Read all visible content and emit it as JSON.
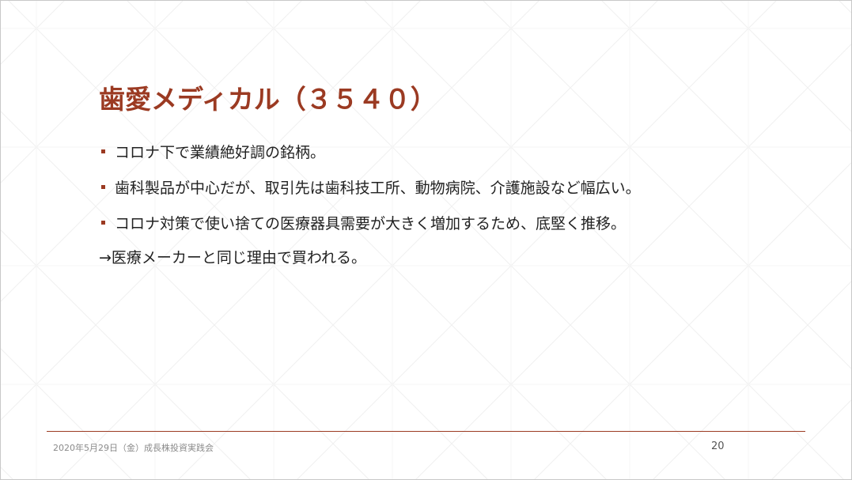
{
  "slide": {
    "title": "歯愛メディカル（３５４０）",
    "bullets": [
      {
        "text": "コロナ下で業績絶好調の銘柄。"
      },
      {
        "text": "歯科製品が中心だが、取引先は歯科技工所、動物病院、介護施設など幅広い。"
      },
      {
        "text": "コロナ対策で使い捨ての医療器具需要が大きく増加するため、底堅く推移。"
      }
    ],
    "note": "→医療メーカーと同じ理由で買われる。",
    "footer": "2020年5月29日（金）成長株投資実践会",
    "page_number": "20"
  },
  "colors": {
    "accent": "#9b3a22",
    "body_text": "#222222",
    "footer_text": "#8a8a8a",
    "background_pattern": "#f1f1f1"
  }
}
